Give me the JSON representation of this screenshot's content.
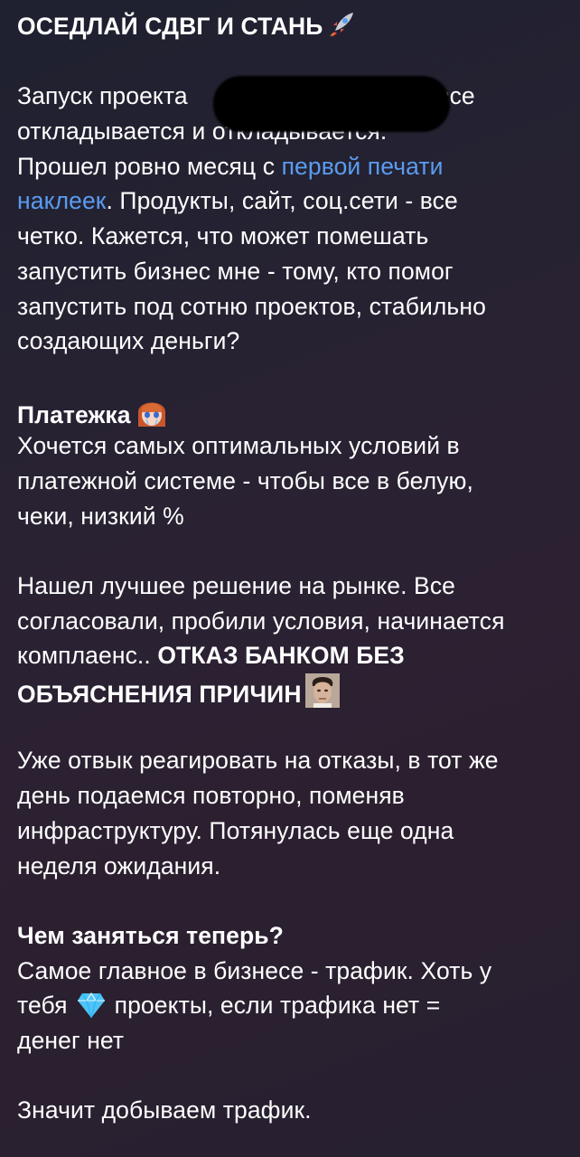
{
  "post": {
    "title": "ОСЕДЛАЙ СДВГ И СТАНЬ",
    "title_emoji": "rocket-icon",
    "p1_line1_a": "Запуск проекта",
    "p1_line1_b": "все",
    "p1_line2": "откладывается и откладывается.",
    "p1_line3_a": "Прошел ровно месяц с ",
    "link_text_1": "первой печати",
    "link_text_2": "наклеек",
    "p1_line4_b": ". Продукты, сайт, соц.сети - все",
    "p1_line5": "четко. Кажется, что может помешать",
    "p1_line6": "запустить бизнес мне - тому, кто помог",
    "p1_line7": "запустить под сотню проектов, стабильно",
    "p1_line8": "создающих деньги?",
    "h2": "Платежка",
    "h2_emoji": "crying-anime-girl-icon",
    "p2_line1": "Хочется самых оптимальных условий в",
    "p2_line2": "платежной системе - чтобы все в белую,",
    "p2_line3": "чеки, низкий %",
    "p3_line1": "Нашел лучшее решение на рынке. Все",
    "p3_line2": "согласовали, пробили условия, начинается",
    "p3_line3_a": "комплаенс.. ",
    "p3_line3_b": "ОТКАЗ БАНКОМ БЕЗ",
    "p3_line4": "ОБЪЯСНЕНИЯ ПРИЧИН",
    "p3_emoji": "bateman-face-icon",
    "p4_line1": "Уже отвык реагировать на отказы, в тот же",
    "p4_line2": "день подаемся повторно, поменяв",
    "p4_line3": "инфраструктуру. Потянулась еще одна",
    "p4_line4": "неделя ожидания.",
    "h3": "Чем заняться теперь?",
    "p5_line1": "Самое главное в бизнесе - трафик. Хоть у",
    "p5_line2_a": "тебя",
    "p5_emoji": "gem-icon",
    "p5_line2_b": "проекты, если трафика нет =",
    "p5_line3": "денег нет",
    "p6_line1": "Значит добываем трафик."
  },
  "colors": {
    "background": "#261f2e",
    "text": "#ffffff",
    "link": "#5a9cf0"
  }
}
